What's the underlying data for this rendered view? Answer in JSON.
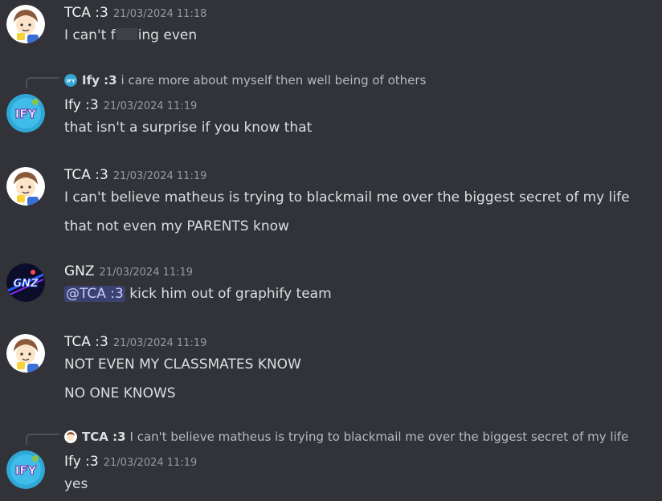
{
  "messages": [
    {
      "author": "TCA :3",
      "timestamp": "21/03/2024 11:18",
      "lines": [
        "I can't f",
        "ing even"
      ]
    },
    {
      "reply": {
        "author": "Ify :3",
        "text": "i care more about myself then well being of others"
      },
      "author": "Ify :3",
      "timestamp": "21/03/2024 11:19",
      "lines": [
        "that isn't a surprise if you know that"
      ]
    },
    {
      "author": "TCA :3",
      "timestamp": "21/03/2024 11:19",
      "lines": [
        "I can't believe matheus is trying to blackmail me over the biggest secret of my life",
        "that not even my PARENTS know"
      ]
    },
    {
      "author": "GNZ",
      "timestamp": "21/03/2024 11:19",
      "mention": "@TCA :3",
      "lines": [
        "kick him out of graphify team"
      ]
    },
    {
      "author": "TCA :3",
      "timestamp": "21/03/2024 11:19",
      "lines": [
        "NOT EVEN MY CLASSMATES KNOW",
        "NO ONE KNOWS"
      ]
    },
    {
      "reply": {
        "author": "TCA :3",
        "text": "I can't believe matheus is trying to blackmail me over the biggest secret of my life"
      },
      "author": "Ify :3",
      "timestamp": "21/03/2024 11:19",
      "lines": [
        "yes"
      ]
    }
  ],
  "avatars": {
    "ify_text": "IFY",
    "gnz_text": "GNZ"
  },
  "colors": {
    "background": "#313338",
    "mention_bg": "#3c4270",
    "timestamp": "#949ba4"
  }
}
